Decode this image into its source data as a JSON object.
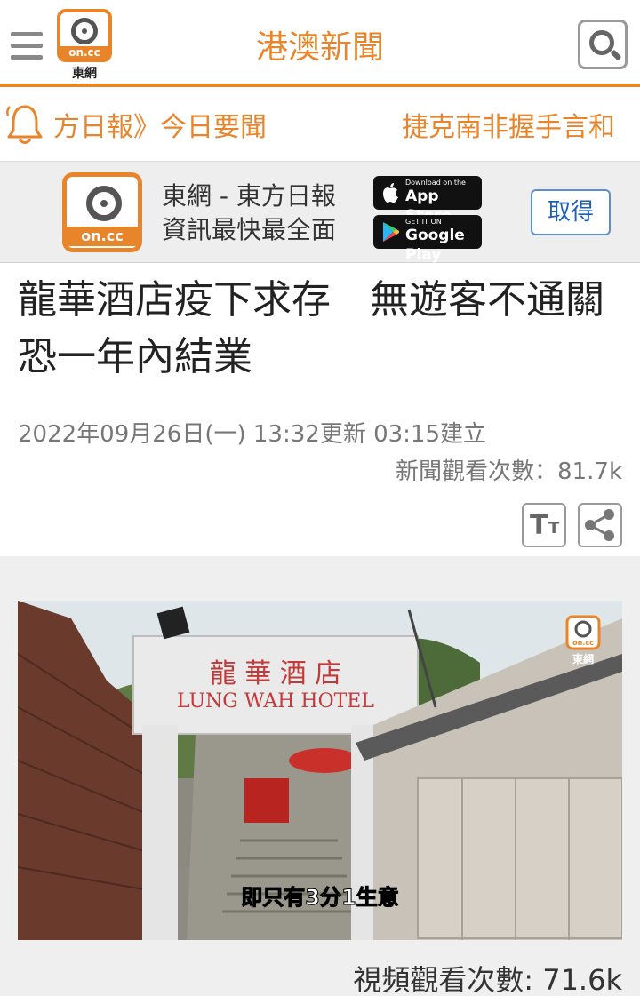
{
  "header": {
    "logo_text": "on.cc",
    "logo_sub": "東網",
    "title": "港澳新聞",
    "menu_icon": "hamburger-icon",
    "search_icon": "search-icon",
    "accent_color": "#e8852b"
  },
  "ticker": {
    "icon": "bell-icon",
    "left_text": "方日報》今日要聞",
    "right_text": "捷克南非握手言和"
  },
  "app_banner": {
    "logo_text": "on.cc",
    "line1": "東網 - 東方日報",
    "line2": "資訊最快最全面",
    "app_store": {
      "small": "Download on the",
      "big": "App Store",
      "icon": "apple-icon"
    },
    "google_play": {
      "small": "GET IT ON",
      "big": "Google Play",
      "icon": "google-play-icon"
    },
    "cancel_label": "取得"
  },
  "article": {
    "title": "龍華酒店疫下求存　無遊客不通關　恐一年內結業",
    "timestamp": "2022年09月26日(一) 13:32更新 03:15建立",
    "views": "新聞觀看次數：81.7k",
    "font_size_icon": "font-size-icon",
    "share_icon": "share-icon"
  },
  "video": {
    "sign_chinese": "龍 華 酒 店",
    "sign_english": "LUNG WAH HOTEL",
    "watermark_text": "on.cc",
    "watermark_sub": "東網",
    "subtitle": "即只有3分1生意",
    "views": "視頻觀看次數: 71.6k"
  }
}
